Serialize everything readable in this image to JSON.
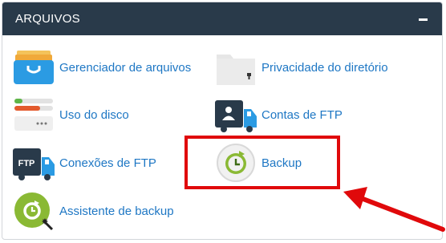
{
  "panel": {
    "title": "ARQUIVOS",
    "collapse_icon": "minus-icon"
  },
  "items": [
    {
      "label": "Gerenciador de arquivos",
      "icon": "file-manager-icon"
    },
    {
      "label": "Privacidade do diretório",
      "icon": "folder-lock-icon"
    },
    {
      "label": "Uso do disco",
      "icon": "disk-usage-icon"
    },
    {
      "label": "Contas de FTP",
      "icon": "ftp-accounts-icon"
    },
    {
      "label": "Conexões de FTP",
      "icon": "ftp-connections-icon"
    },
    {
      "label": "Backup",
      "icon": "backup-icon"
    },
    {
      "label": "Assistente de backup",
      "icon": "backup-wizard-icon"
    }
  ],
  "annotation": {
    "highlight_color": "#e0090b",
    "arrow_icon": "red-arrow-icon"
  },
  "colors": {
    "header_bg": "#293a4a",
    "link": "#1e77c4"
  }
}
